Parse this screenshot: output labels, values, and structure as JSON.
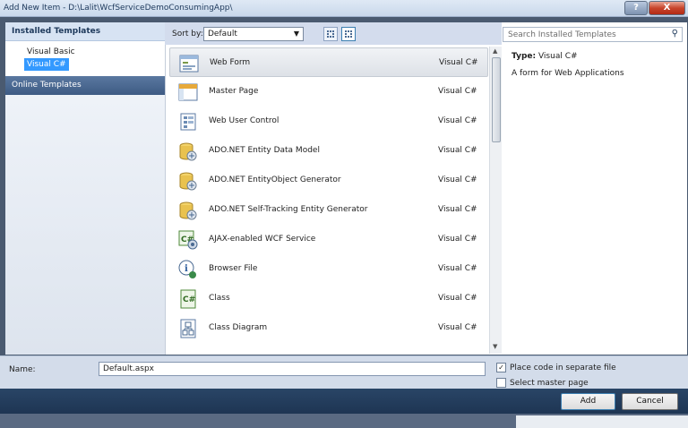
{
  "window": {
    "title": "Add New Item - D:\\Lalit\\WcfServiceDemoConsumingApp\\",
    "help_label": "?",
    "close_label": "X"
  },
  "left_pane": {
    "installed_header": "Installed Templates",
    "items": [
      {
        "label": "Visual Basic",
        "selected": false
      },
      {
        "label": "Visual C#",
        "selected": true
      }
    ],
    "online_header": "Online Templates"
  },
  "toolbar": {
    "sort_label": "Sort by:",
    "sort_value": "Default"
  },
  "search": {
    "placeholder": "Search Installed Templates"
  },
  "templates": [
    {
      "name": "Web Form",
      "lang": "Visual C#",
      "icon": "web-form-icon",
      "selected": true
    },
    {
      "name": "Master Page",
      "lang": "Visual C#",
      "icon": "master-page-icon"
    },
    {
      "name": "Web User Control",
      "lang": "Visual C#",
      "icon": "user-control-icon"
    },
    {
      "name": "ADO.NET Entity Data Model",
      "lang": "Visual C#",
      "icon": "database-icon"
    },
    {
      "name": "ADO.NET EntityObject Generator",
      "lang": "Visual C#",
      "icon": "database-icon"
    },
    {
      "name": "ADO.NET Self-Tracking Entity Generator",
      "lang": "Visual C#",
      "icon": "database-icon"
    },
    {
      "name": "AJAX-enabled WCF Service",
      "lang": "Visual C#",
      "icon": "wcf-service-icon"
    },
    {
      "name": "Browser File",
      "lang": "Visual C#",
      "icon": "browser-file-icon"
    },
    {
      "name": "Class",
      "lang": "Visual C#",
      "icon": "class-icon"
    },
    {
      "name": "Class Diagram",
      "lang": "Visual C#",
      "icon": "class-diagram-icon"
    }
  ],
  "details": {
    "type_label": "Type:",
    "type_value": "Visual C#",
    "description": "A form for Web Applications"
  },
  "bottom": {
    "name_label": "Name:",
    "name_value": "Default.aspx",
    "place_code_label": "Place code in separate file",
    "place_code_checked": true,
    "master_page_label": "Select master page",
    "master_page_checked": false
  },
  "buttons": {
    "add": "Add",
    "cancel": "Cancel"
  }
}
